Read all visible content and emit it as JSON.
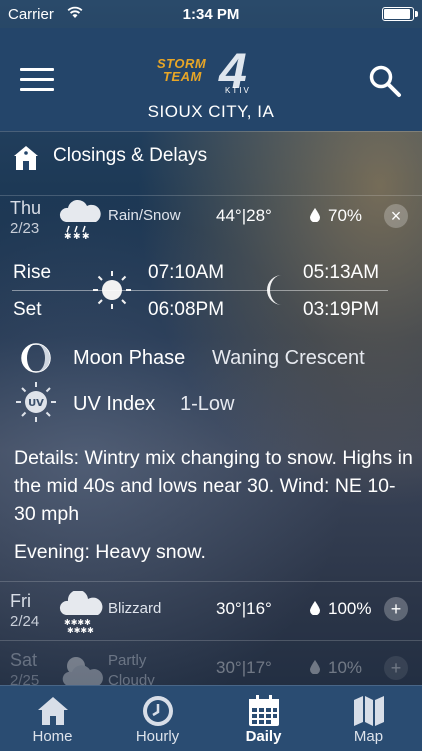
{
  "status": {
    "carrier": "Carrier",
    "time": "1:34 PM",
    "battery_level": 0.92
  },
  "header": {
    "logo_line1": "STORM",
    "logo_line2": "TEAM",
    "logo_number": "4",
    "logo_sub": "KTIV",
    "city": "SIOUX CITY, IA"
  },
  "closings": {
    "label": "Closings & Delays"
  },
  "days": [
    {
      "day": "Thu",
      "date": "2/23",
      "condition": "Rain/Snow",
      "temps": "44°|28°",
      "precip": "70%",
      "toggle": "×",
      "icon": "rain-snow-icon"
    },
    {
      "day": "Fri",
      "date": "2/24",
      "condition": "Blizzard",
      "temps": "30°|16°",
      "precip": "100%",
      "toggle": "+",
      "icon": "blizzard-icon"
    },
    {
      "day": "Sat",
      "date": "2/25",
      "condition": "Partly Cloudy",
      "temps": "30°|17°",
      "precip": "10%",
      "toggle": "+",
      "icon": "partly-cloudy-icon"
    }
  ],
  "expanded": {
    "rise_label": "Rise",
    "set_label": "Set",
    "sunrise": "07:10AM",
    "sunset": "06:08PM",
    "moonrise": "05:13AM",
    "moonset": "03:19PM",
    "moon_phase_label": "Moon Phase",
    "moon_phase_value": "Waning Crescent",
    "uv_label": "UV Index",
    "uv_value": "1-Low",
    "uv_icon_text": "UV",
    "details": "Details: Wintry mix changing to snow. Highs in the mid 40s and lows near 30. Wind: NE 10-30 mph",
    "evening": "Evening: Heavy snow."
  },
  "tabs": [
    {
      "label": "Home",
      "icon": "home-icon",
      "active": false
    },
    {
      "label": "Hourly",
      "icon": "clock-icon",
      "active": false
    },
    {
      "label": "Daily",
      "icon": "calendar-icon",
      "active": true
    },
    {
      "label": "Map",
      "icon": "map-icon",
      "active": false
    }
  ],
  "colors": {
    "header": "#24456a",
    "tabbar": "#2a4c72",
    "logo_accent": "#e8a626"
  }
}
